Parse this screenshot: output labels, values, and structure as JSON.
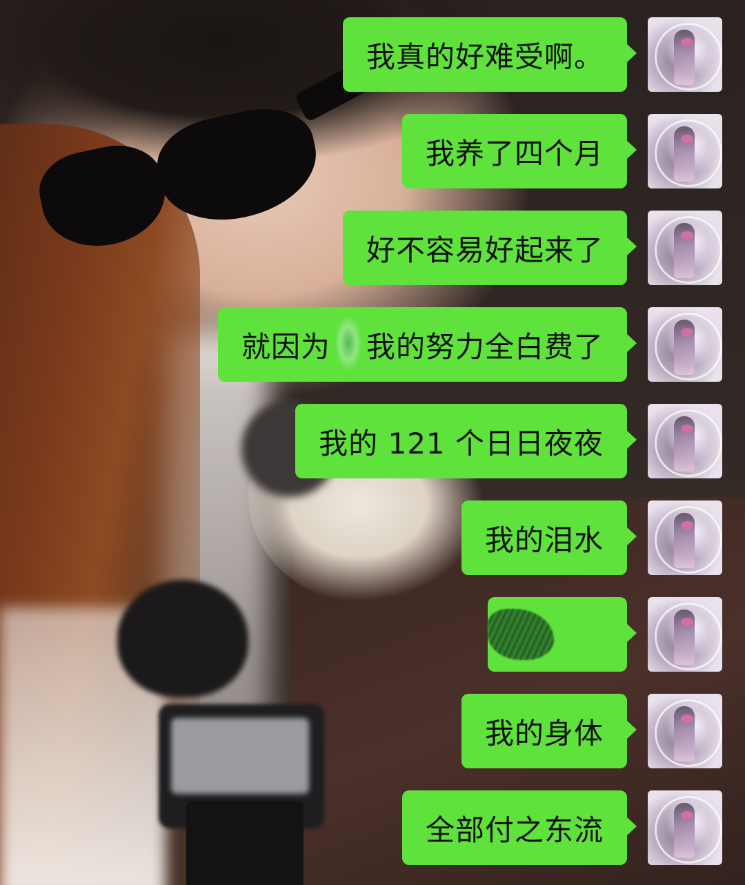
{
  "messages": [
    {
      "text": "我真的好难受啊。"
    },
    {
      "text": "我养了四个月"
    },
    {
      "text": "好不容易好起来了"
    },
    {
      "text_before": "就因为",
      "text_after": "我的努力全白费了"
    },
    {
      "text": "我的 121 个日日夜夜"
    },
    {
      "text": "我的泪水"
    },
    {
      "text": ""
    },
    {
      "text": "我的身体"
    },
    {
      "text": "全部付之东流"
    }
  ],
  "colors": {
    "bubble": "#5fe23b",
    "text": "#111111"
  },
  "icons": {
    "avatar": "anime-character-avatar"
  }
}
